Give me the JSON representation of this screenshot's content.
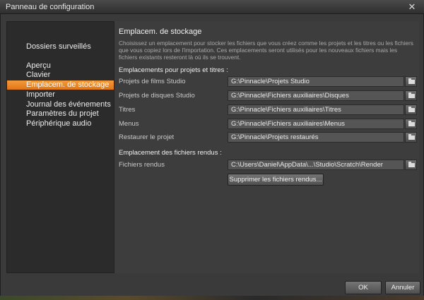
{
  "window": {
    "title": "Panneau de configuration"
  },
  "sidebar": {
    "items": [
      {
        "label": "Dossiers surveillés"
      },
      {
        "label": "Aperçu"
      },
      {
        "label": "Clavier"
      },
      {
        "label": "Emplacem. de stockage",
        "active": true
      },
      {
        "label": "Importer"
      },
      {
        "label": "Journal des événements"
      },
      {
        "label": "Paramètres du projet"
      },
      {
        "label": "Périphérique audio"
      }
    ]
  },
  "content": {
    "title": "Emplacem. de stockage",
    "description": "Choisissez un emplacement pour stocker les fichiers que vous créez comme les projets et les titres ou les fichiers que vous copiez lors de l'importation. Ces emplacements seront utilisés pour les nouveaux fichiers mais les fichiers existants resteront là où ils se trouvent.",
    "projects_section": "Emplacements pour projets et titres :",
    "rows": [
      {
        "label": "Projets de films Studio",
        "path": "G:\\Pinnacle\\Projets Studio"
      },
      {
        "label": "Projets de disques Studio",
        "path": "G:\\Pinnacle\\Fichiers auxiliaires\\Disques"
      },
      {
        "label": "Titres",
        "path": "G:\\Pinnacle\\Fichiers auxiliaires\\Titres"
      },
      {
        "label": "Menus",
        "path": "G:\\Pinnacle\\Fichiers auxiliaires\\Menus"
      },
      {
        "label": "Restaurer le projet",
        "path": "G:\\Pinnacle\\Projets restaurés"
      }
    ],
    "render_section": "Emplacement des fichiers rendus :",
    "render_row": {
      "label": "Fichiers rendus",
      "path": "C:\\Users\\Daniel\\AppData\\...\\Studio\\Scratch\\Render"
    },
    "delete_button": "Supprimer les fichiers rendus..."
  },
  "footer": {
    "ok": "OK",
    "cancel": "Annuler"
  },
  "icons": {
    "close": "close-icon",
    "browse": "folder-icon"
  },
  "colors": {
    "accent": "#ee8a2a",
    "background": "#3a3a3a"
  }
}
